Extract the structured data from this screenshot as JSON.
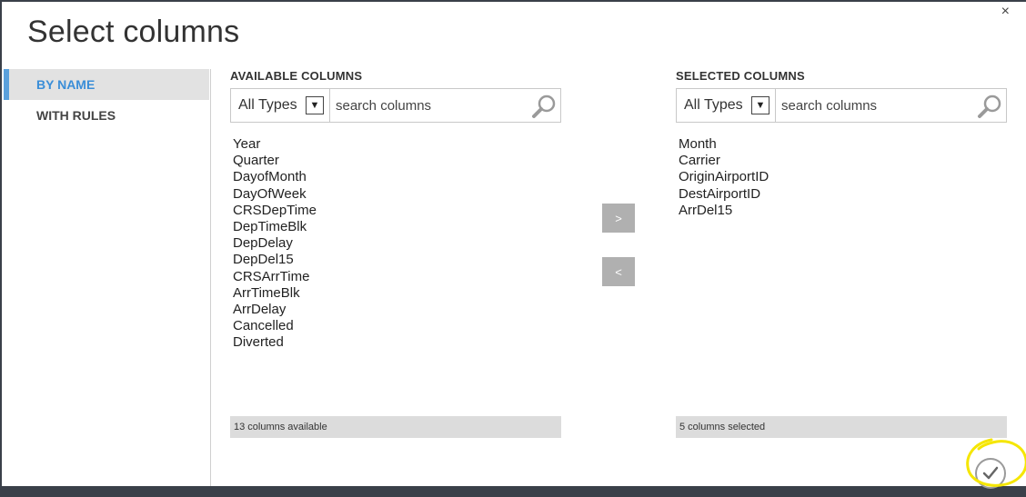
{
  "dialog": {
    "title": "Select columns",
    "close_glyph": "×"
  },
  "nav": {
    "items": [
      {
        "label": "BY NAME",
        "active": true
      },
      {
        "label": "WITH RULES",
        "active": false
      }
    ]
  },
  "available": {
    "label": "AVAILABLE COLUMNS",
    "type_filter": "All Types",
    "search_placeholder": "search columns",
    "columns": [
      "Year",
      "Quarter",
      "DayofMonth",
      "DayOfWeek",
      "CRSDepTime",
      "DepTimeBlk",
      "DepDelay",
      "DepDel15",
      "CRSArrTime",
      "ArrTimeBlk",
      "ArrDelay",
      "Cancelled",
      "Diverted"
    ],
    "status": "13 columns available"
  },
  "selected": {
    "label": "SELECTED COLUMNS",
    "type_filter": "All Types",
    "search_placeholder": "search columns",
    "columns": [
      "Month",
      "Carrier",
      "OriginAirportID",
      "DestAirportID",
      "ArrDel15"
    ],
    "status": "5 columns selected"
  },
  "buttons": {
    "add_label": ">",
    "remove_label": "<"
  },
  "colors": {
    "accent": "#3a8ed8",
    "highlight_ring": "#f5e600"
  },
  "icons": {
    "search": "search-icon",
    "ok": "checkmark-icon",
    "dropdown": "chevron-down-icon",
    "close": "close-icon"
  }
}
